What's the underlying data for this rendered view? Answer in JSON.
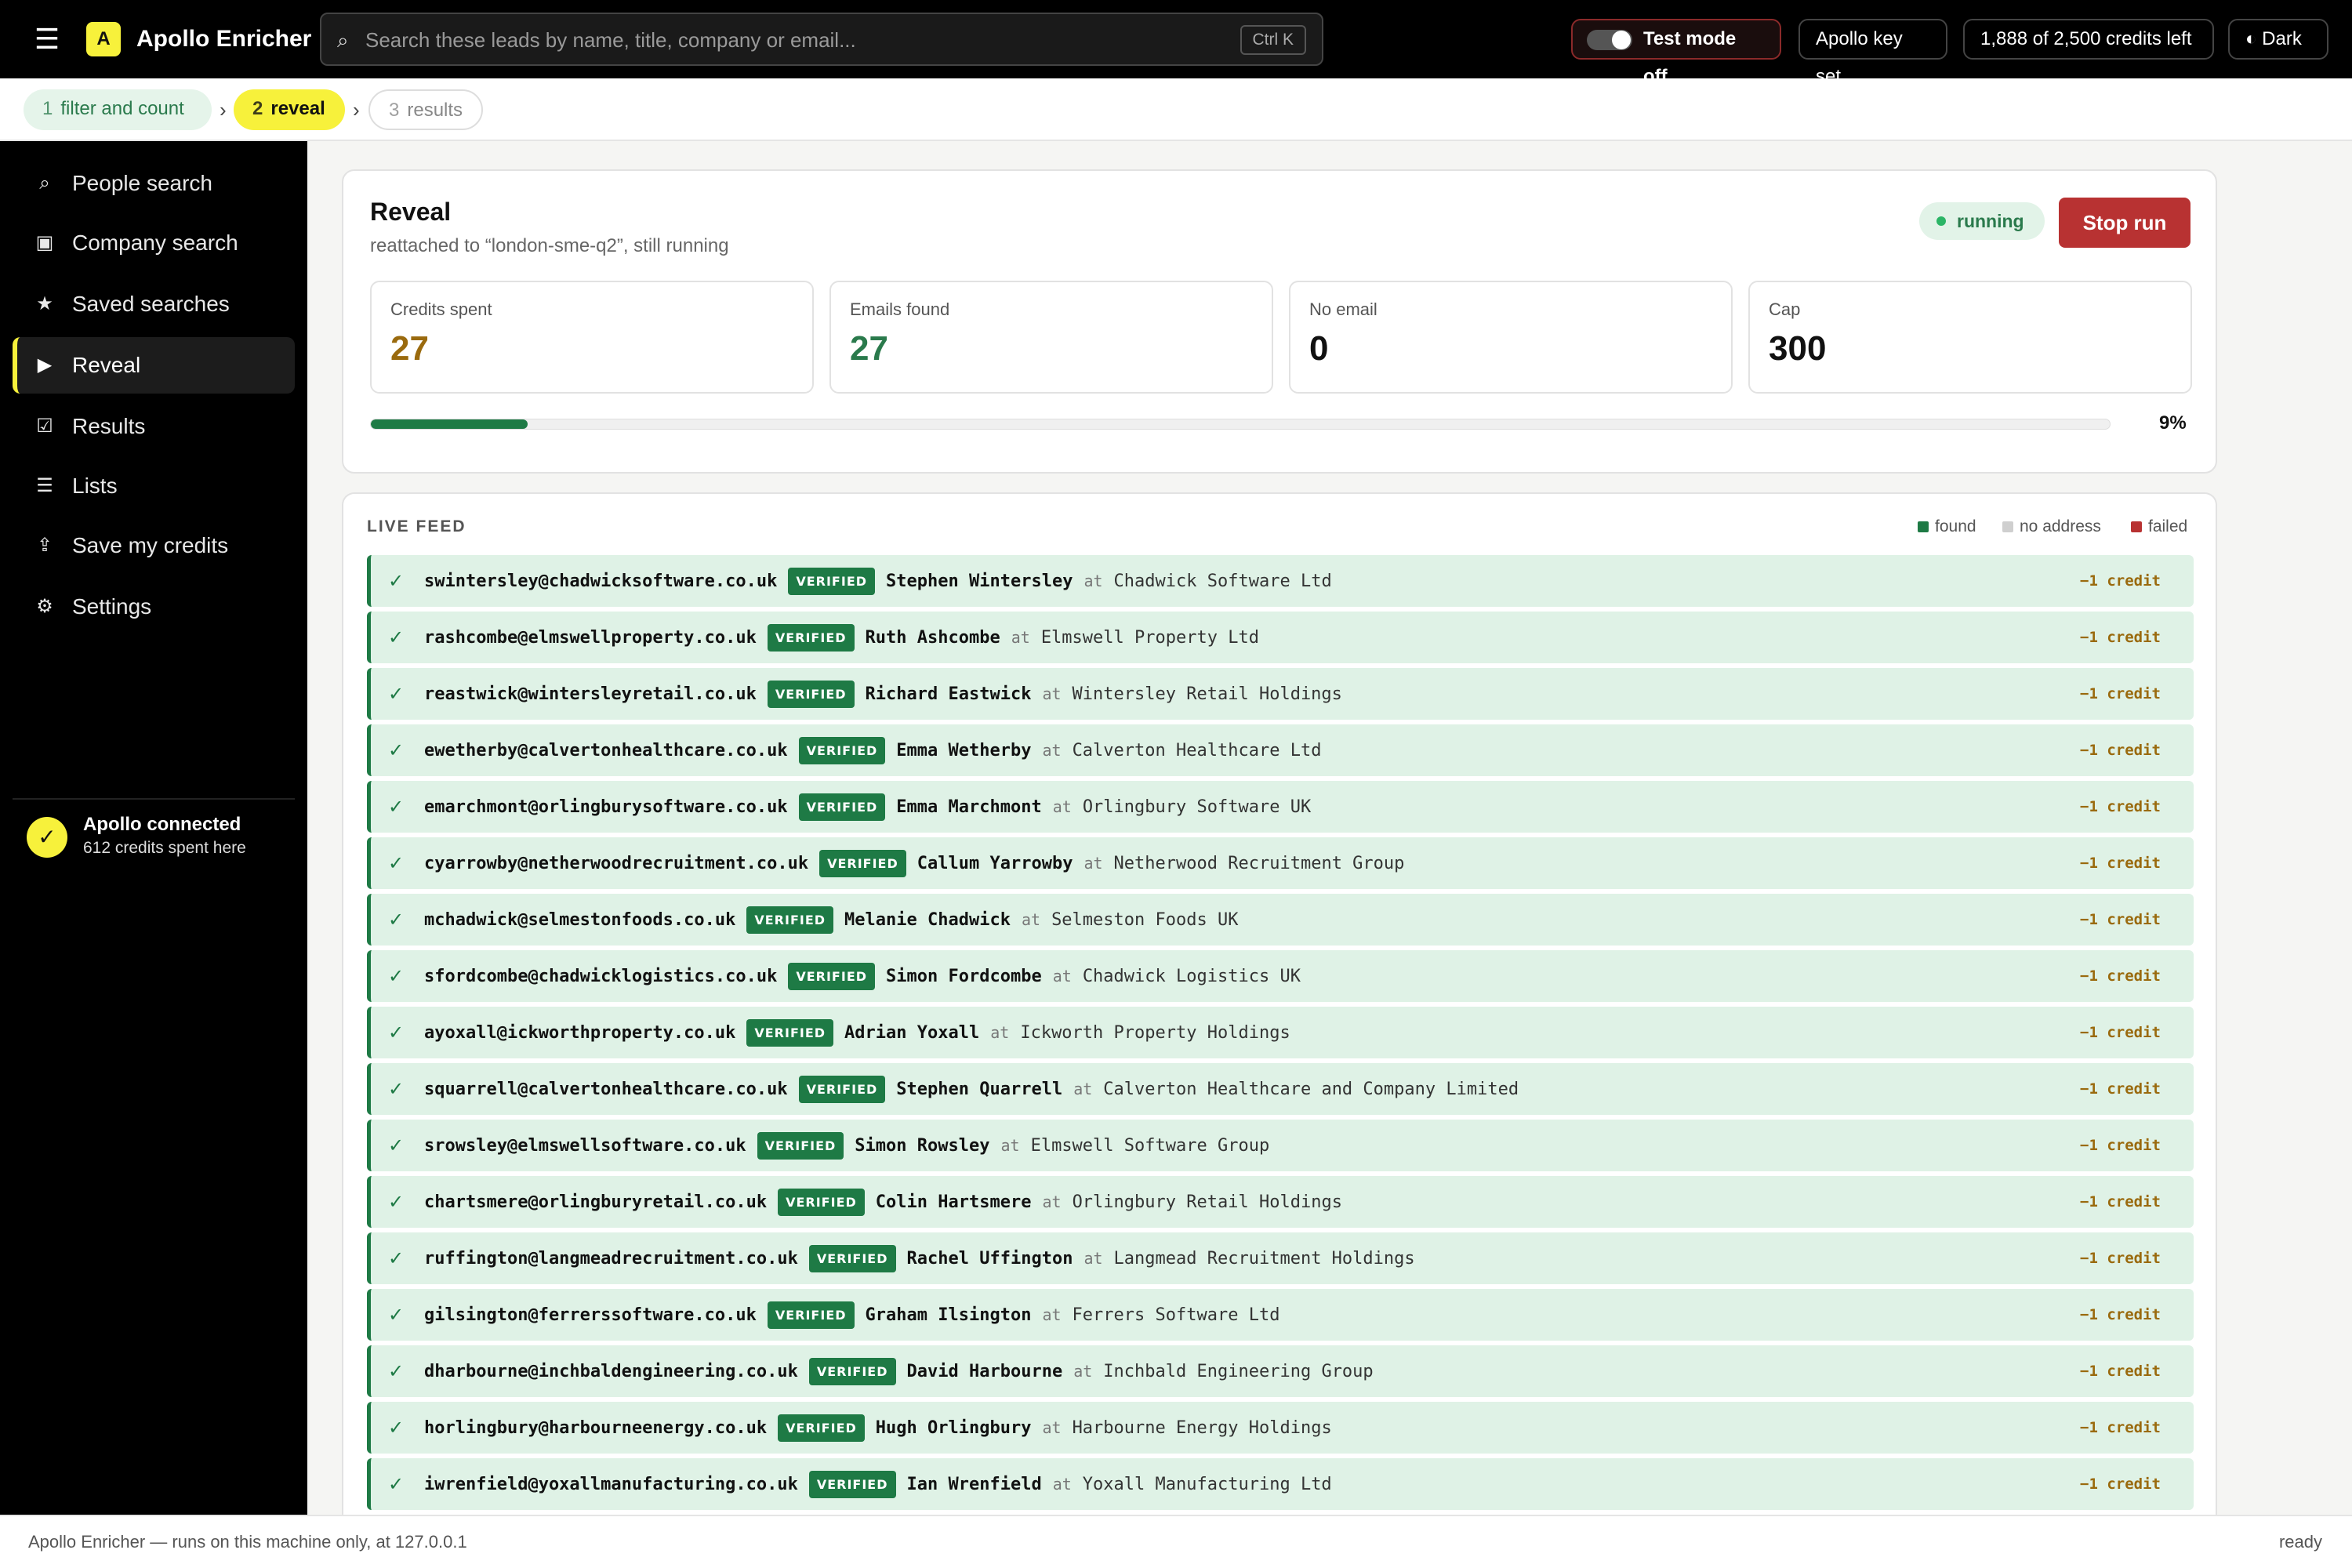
{
  "header": {
    "app_title": "Apollo Enricher",
    "logo_letter": "A",
    "menu_icon": "hamburger-icon",
    "search_placeholder": "Search these leads by name, title, company or email...",
    "search_shortcut": "Ctrl K",
    "test_mode_label": "Test mode off",
    "apollo_key_label": "Apollo key set",
    "credits_label": "1,888 of 2,500 credits left",
    "theme_label": "◐ Dark"
  },
  "breadcrumb": [
    {
      "num": "1",
      "label": "filter and count"
    },
    {
      "num": "2",
      "label": "reveal"
    },
    {
      "num": "3",
      "label": "results"
    }
  ],
  "sidebar": {
    "items": [
      {
        "icon": "⌕",
        "icon_name": "search-icon",
        "label": "People search"
      },
      {
        "icon": "▣",
        "icon_name": "building-icon",
        "label": "Company search"
      },
      {
        "icon": "★",
        "icon_name": "star-icon",
        "label": "Saved searches"
      },
      {
        "icon": "▶",
        "icon_name": "play-icon",
        "label": "Reveal"
      },
      {
        "icon": "☑",
        "icon_name": "checkbox-icon",
        "label": "Results"
      },
      {
        "icon": "☰",
        "icon_name": "list-icon",
        "label": "Lists"
      },
      {
        "icon": "⇪",
        "icon_name": "piggy-bank-icon",
        "label": "Save my credits"
      },
      {
        "icon": "⚙",
        "icon_name": "gear-icon",
        "label": "Settings"
      }
    ],
    "active_index": 3,
    "connection": {
      "icon": "✓",
      "title": "Apollo connected",
      "subtitle": "612 credits spent here"
    }
  },
  "reveal": {
    "title": "Reveal",
    "subtitle": "reattached to “london-sme-q2”, still running",
    "status": "running",
    "stop_label": "Stop run",
    "stats": [
      {
        "label": "Credits spent",
        "value": "27"
      },
      {
        "label": "Emails found",
        "value": "27"
      },
      {
        "label": "No email",
        "value": "0"
      },
      {
        "label": "Cap",
        "value": "300"
      }
    ],
    "progress_percent": 9,
    "progress_label": "9%"
  },
  "feed": {
    "title": "LIVE FEED",
    "legend": [
      "found",
      "no address",
      "failed"
    ],
    "verified_label": "VERIFIED",
    "at_label": "at",
    "credit_label": "−1 credit",
    "colors": {
      "found": "#1e7a45",
      "no_address": "#cfcfcf",
      "failed": "#b83232",
      "row_bg": "#dff2e6"
    },
    "rows": [
      {
        "email": "swintersley@chadwicksoftware.co.uk",
        "name": "Stephen Wintersley",
        "company": "Chadwick Software Ltd"
      },
      {
        "email": "rashcombe@elmswellproperty.co.uk",
        "name": "Ruth Ashcombe",
        "company": "Elmswell Property Ltd"
      },
      {
        "email": "reastwick@wintersleyretail.co.uk",
        "name": "Richard Eastwick",
        "company": "Wintersley Retail Holdings"
      },
      {
        "email": "ewetherby@calvertonhealthcare.co.uk",
        "name": "Emma Wetherby",
        "company": "Calverton Healthcare Ltd"
      },
      {
        "email": "emarchmont@orlingburysoftware.co.uk",
        "name": "Emma Marchmont",
        "company": "Orlingbury Software UK"
      },
      {
        "email": "cyarrowby@netherwoodrecruitment.co.uk",
        "name": "Callum Yarrowby",
        "company": "Netherwood Recruitment Group"
      },
      {
        "email": "mchadwick@selmestonfoods.co.uk",
        "name": "Melanie Chadwick",
        "company": "Selmeston Foods UK"
      },
      {
        "email": "sfordcombe@chadwicklogistics.co.uk",
        "name": "Simon Fordcombe",
        "company": "Chadwick Logistics UK"
      },
      {
        "email": "ayoxall@ickworthproperty.co.uk",
        "name": "Adrian Yoxall",
        "company": "Ickworth Property Holdings"
      },
      {
        "email": "squarrell@calvertonhealthcare.co.uk",
        "name": "Stephen Quarrell",
        "company": "Calverton Healthcare and Company Limited"
      },
      {
        "email": "srowsley@elmswellsoftware.co.uk",
        "name": "Simon Rowsley",
        "company": "Elmswell Software Group"
      },
      {
        "email": "chartsmere@orlingburyretail.co.uk",
        "name": "Colin Hartsmere",
        "company": "Orlingbury Retail Holdings"
      },
      {
        "email": "ruffington@langmeadrecruitment.co.uk",
        "name": "Rachel Uffington",
        "company": "Langmead Recruitment Holdings"
      },
      {
        "email": "gilsington@ferrerssoftware.co.uk",
        "name": "Graham Ilsington",
        "company": "Ferrers Software Ltd"
      },
      {
        "email": "dharbourne@inchbaldengineering.co.uk",
        "name": "David Harbourne",
        "company": "Inchbald Engineering Group"
      },
      {
        "email": "horlingbury@harbourneenergy.co.uk",
        "name": "Hugh Orlingbury",
        "company": "Harbourne Energy Holdings"
      },
      {
        "email": "iwrenfield@yoxallmanufacturing.co.uk",
        "name": "Ian Wrenfield",
        "company": "Yoxall Manufacturing Ltd"
      }
    ]
  },
  "footer": {
    "left": "Apollo Enricher — runs on this machine only, at 127.0.0.1",
    "right": "ready"
  }
}
